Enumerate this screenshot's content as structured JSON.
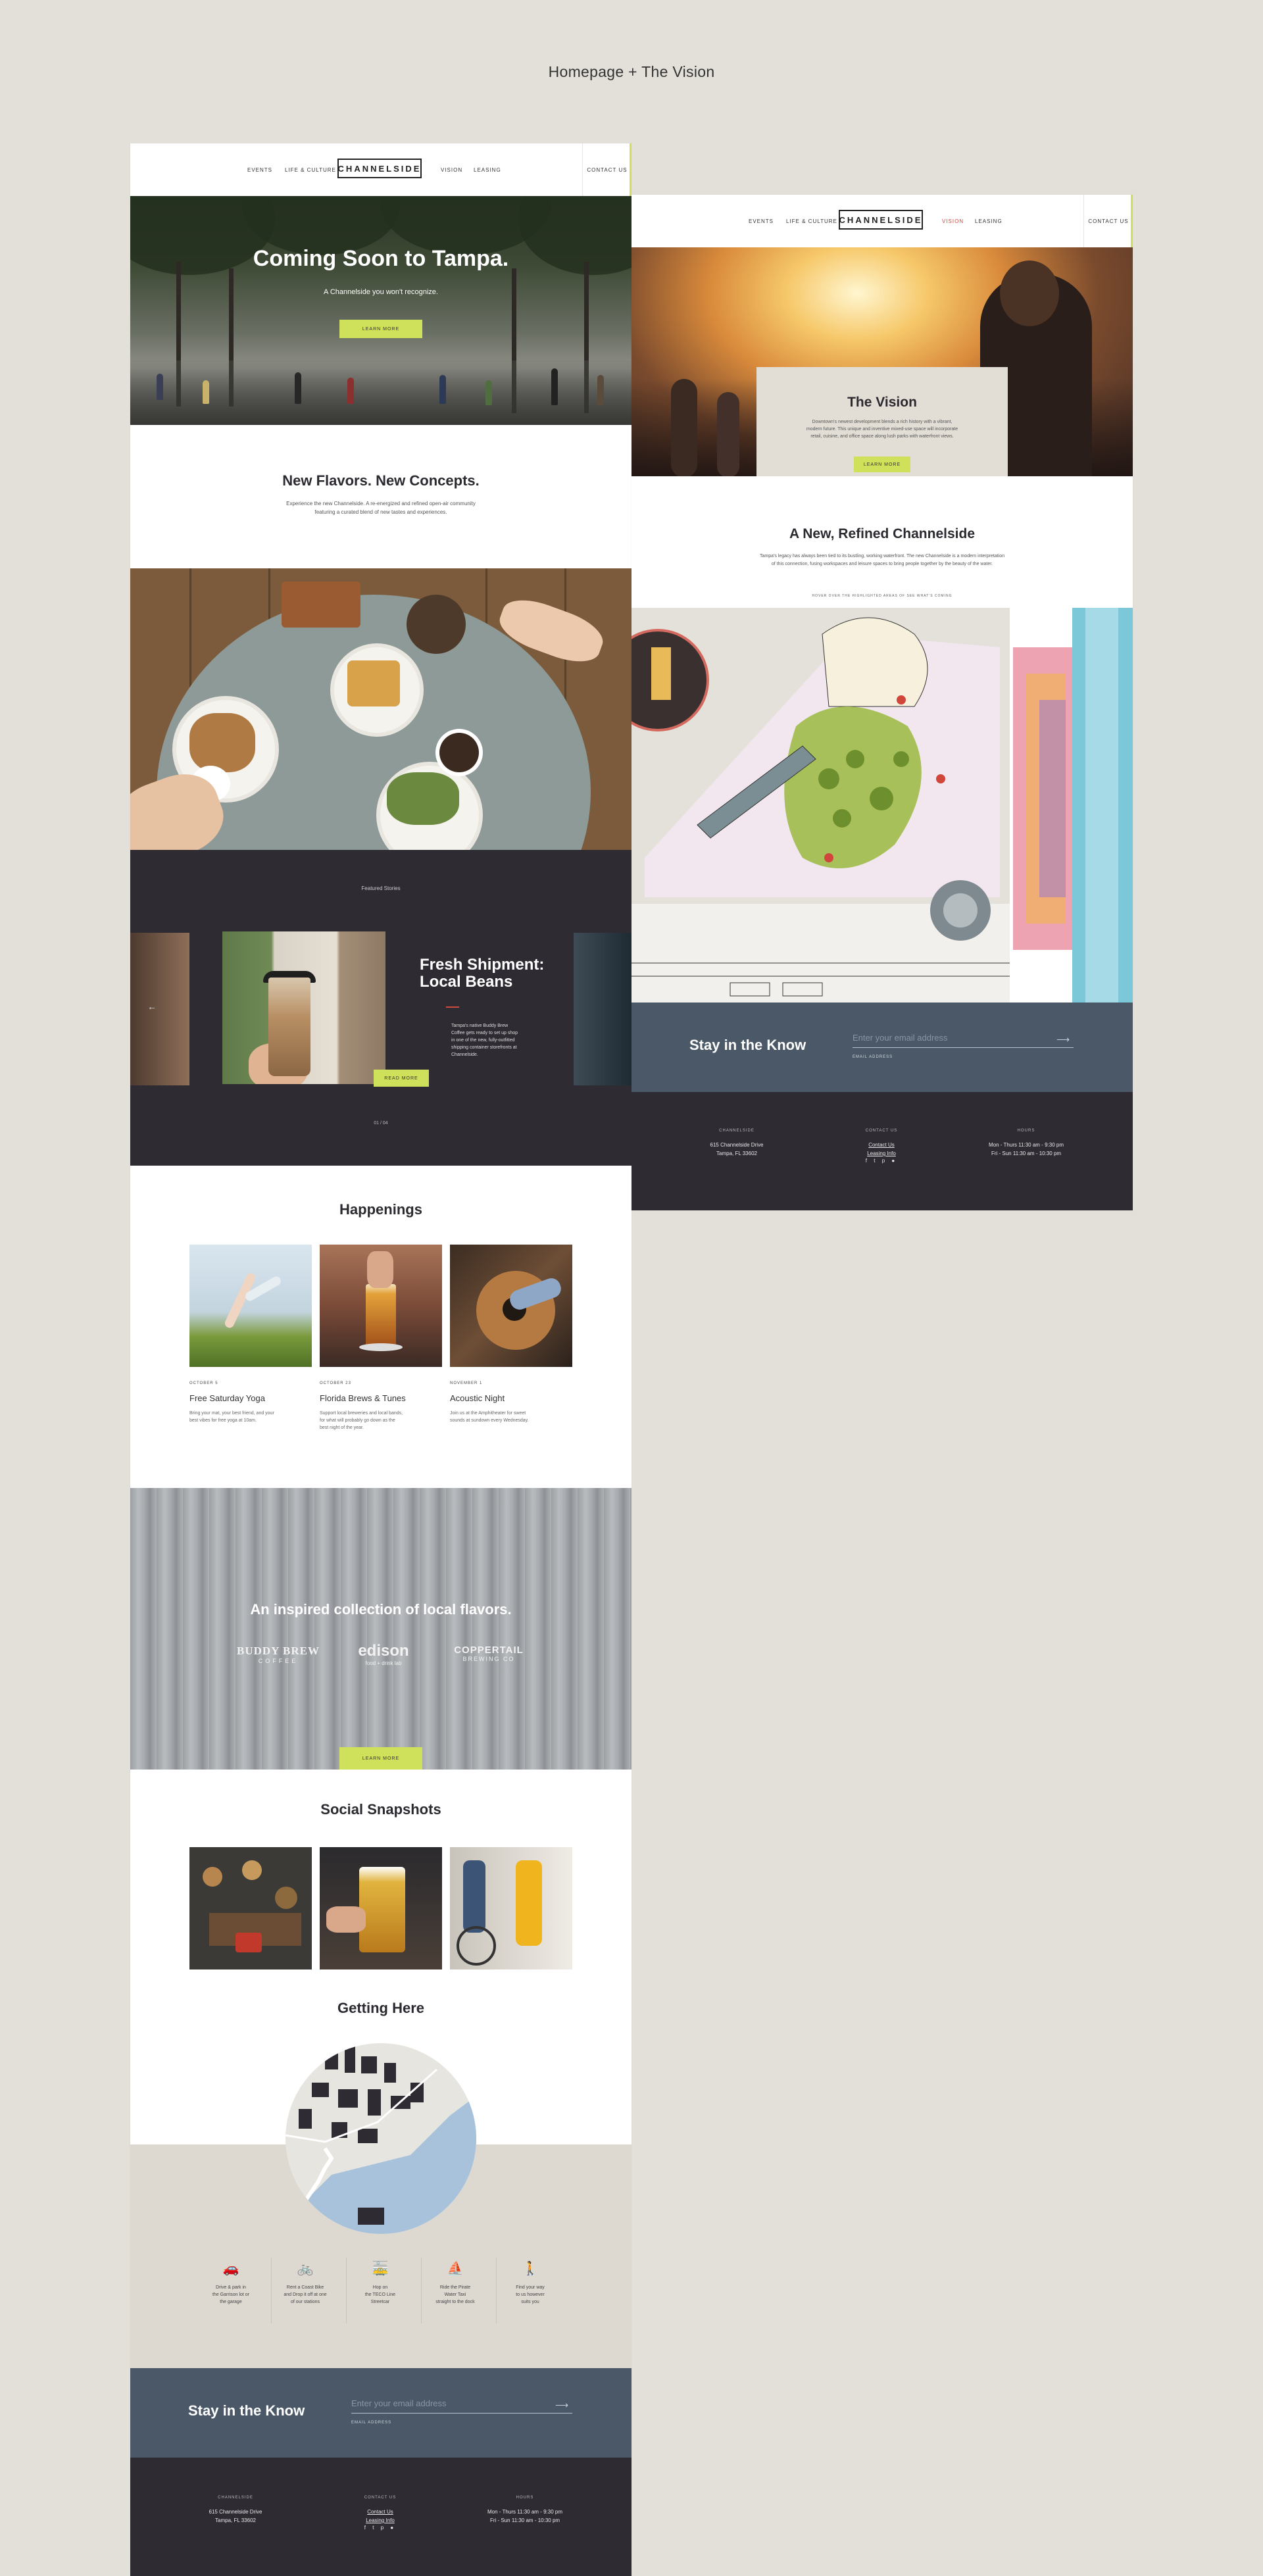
{
  "presentation_title": "Homepage + The Vision",
  "nav": {
    "links": [
      "EVENTS",
      "LIFE & CULTURE",
      "VISION",
      "LEASING"
    ],
    "logo": "CHANNELSIDE",
    "contact": "CONTACT US"
  },
  "home": {
    "hero": {
      "title": "Coming Soon to Tampa.",
      "subtitle": "A Channelside you won't recognize.",
      "button": "LEARN MORE"
    },
    "intro": {
      "title": "New Flavors. New Concepts.",
      "text_line1": "Experience the new Channelside. A re-energized and refined open-air community",
      "text_line2": "featuring a curated blend of new tastes and experiences."
    },
    "featured": {
      "label": "Featured Stories",
      "story_title_line1": "Fresh Shipment:",
      "story_title_line2": "Local Beans",
      "story_text": [
        "Tampa's native Buddy Brew",
        "Coffee gets ready to set up shop",
        "in one of the new, fully-outfitted",
        "shipping container storefronts at",
        "Channelside."
      ],
      "button": "READ MORE",
      "pager": "01 / 04",
      "prev_arrow": "←"
    },
    "happenings": {
      "title": "Happenings",
      "items": [
        {
          "date": "OCTOBER 5",
          "title": "Free Saturday Yoga",
          "desc_line1": "Bring your mat, your best friend, and your",
          "desc_line2": "best vibes for free yoga at 10am."
        },
        {
          "date": "OCTOBER 23",
          "title": "Florida Brews & Tunes",
          "desc_line1": "Support local breweries and local bands,",
          "desc_line2": "for what will probably go down as the",
          "desc_line3": "best night of the year."
        },
        {
          "date": "NOVEMBER 1",
          "title": "Acoustic Night",
          "desc_line1": "Join us at the Amphitheater for sweet",
          "desc_line2": "sounds at sundown every Wednesday."
        }
      ]
    },
    "flavors": {
      "title": "An inspired collection of local flavors.",
      "brands": [
        {
          "name": "BUDDY BREW",
          "sub": "COFFEE"
        },
        {
          "name": "edison",
          "sub": "food + drink lab"
        },
        {
          "name": "COPPERTAIL",
          "sub": "BREWING CO"
        }
      ],
      "button": "LEARN MORE"
    },
    "social": {
      "title": "Social Snapshots"
    },
    "getting_here": {
      "title": "Getting Here",
      "options": [
        {
          "icon": "car-icon",
          "glyph": "🚗",
          "lines": [
            "Drive & park in",
            "the Garrison lot or",
            "the garage"
          ]
        },
        {
          "icon": "bike-icon",
          "glyph": "🚲",
          "lines": [
            "Rent a Coast Bike",
            "and Drop it off at one",
            "of our stations"
          ]
        },
        {
          "icon": "streetcar-icon",
          "glyph": "🚋",
          "lines": [
            "Hop on",
            "the TECO Line",
            "Streetcar"
          ]
        },
        {
          "icon": "boat-icon",
          "glyph": "⛵",
          "lines": [
            "Ride the Pirate",
            "Water Taxi",
            "straight to the dock"
          ]
        },
        {
          "icon": "walk-icon",
          "glyph": "🚶",
          "lines": [
            "Find your way",
            "to us however",
            "suits you"
          ]
        }
      ]
    }
  },
  "newsletter": {
    "title": "Stay in the Know",
    "placeholder": "Enter your email address",
    "signup": "EMAIL ADDRESS",
    "arrow": "⟶"
  },
  "footer": {
    "col1": {
      "heading": "CHANNELSIDE",
      "line1": "615 Channelside Drive",
      "line2": "Tampa, FL 33602"
    },
    "col2": {
      "heading": "CONTACT US",
      "line1": "Contact Us",
      "line2": "Leasing Info",
      "social": "f t p ●"
    },
    "col3": {
      "heading": "HOURS",
      "line1": "Mon - Thurs 11:30 am - 9:30 pm",
      "line2": "Fri - Sun 11:30 am - 10:30 pm"
    }
  },
  "vision": {
    "hero": {
      "title": "The Vision",
      "text_line1": "Downtown's newest development blends a rich history with a vibrant,",
      "text_line2": "modern future. This unique and inventive mixed-use space will incorporate",
      "text_line3": "retail, cuisine, and office space along lush parks with waterfront views.",
      "button": "LEARN MORE"
    },
    "intro": {
      "title": "A New, Refined Channelside",
      "text_line1": "Tampa's legacy has always been tied to its bustling, working waterfront. The new Channelside is a modern interpretation",
      "text_line2": "of this connection, fusing workspaces and leisure spaces to bring people together by the beauty of the water.",
      "caption": "HOVER OVER THE HIGHLIGHTED AREAS OF SEE WHAT'S COMING"
    }
  },
  "colors": {
    "accent_lime": "#cfe05a",
    "dark": "#2e2b33",
    "slate": "#4a5868",
    "vision_link_red": "#d0463b"
  }
}
